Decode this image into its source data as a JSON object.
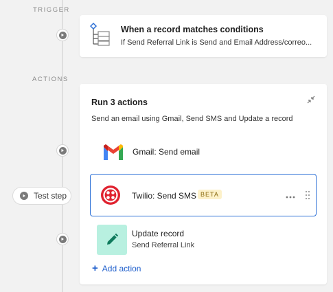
{
  "labels": {
    "trigger": "TRIGGER",
    "actions": "ACTIONS"
  },
  "trigger": {
    "title": "When a record matches conditions",
    "subtitle": "If Send Referral Link is Send and Email Address/correo..."
  },
  "actions": {
    "title": "Run 3 actions",
    "subtitle": "Send an email using Gmail, Send SMS and Update a record",
    "steps": [
      {
        "label": "Gmail: Send email",
        "icon": "gmail-icon"
      },
      {
        "label": "Twilio: Send SMS",
        "badge": "BETA",
        "icon": "twilio-icon"
      },
      {
        "label": "Update record",
        "sublabel": "Send Referral Link",
        "icon": "pencil-icon"
      }
    ],
    "add_action": "Add action"
  },
  "test_step": "Test step",
  "colors": {
    "accent": "#2b6fd6",
    "link": "#1f5fcc",
    "twilio": "#e0222f",
    "update_bg": "#b8f0e0",
    "beta_bg": "#fdf1c9"
  }
}
